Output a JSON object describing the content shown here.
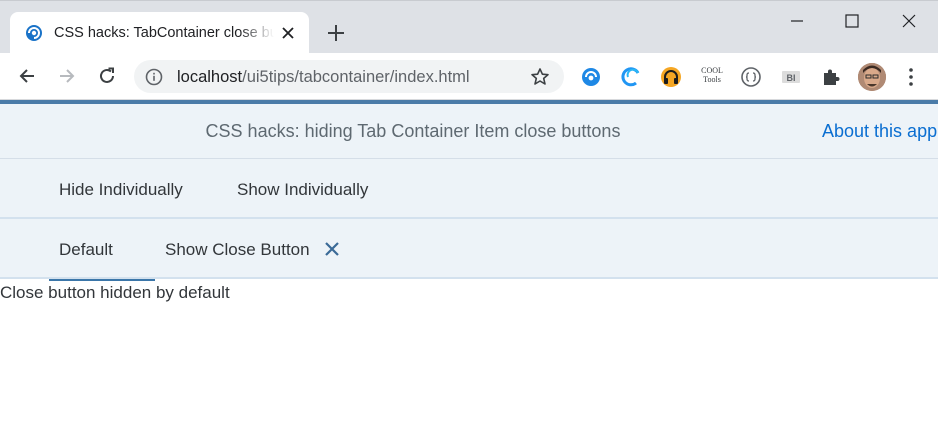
{
  "browser": {
    "tab_title": "CSS hacks: TabContainer close buttons",
    "url_host": "localhost",
    "url_path": "/ui5tips/tabcontainer/index.html",
    "extensions": [
      "ui5-inspector-icon",
      "edge-icon",
      "headphones-icon",
      "tools-icon",
      "json-icon",
      "bi-icon",
      "puzzle-icon"
    ],
    "ext_tools_label": "COOL Tools",
    "ext_bi_label": "BI"
  },
  "app": {
    "title": "CSS hacks: hiding Tab Container Item close buttons",
    "about_link": "About this app",
    "outer_tabs": [
      {
        "label": "Hide Individually",
        "selected": false
      },
      {
        "label": "Show Individually",
        "selected": true
      }
    ],
    "inner_tabs": [
      {
        "label": "Default",
        "selected": true
      },
      {
        "label": "Show Close Button",
        "selected": false
      }
    ],
    "content_text": "Close button hidden by default"
  },
  "colors": {
    "accent": "#4a7ba8",
    "header_bg": "#edf3f8",
    "link": "#0a6ed1",
    "selected_tab_indicator": "#3b76a9"
  }
}
